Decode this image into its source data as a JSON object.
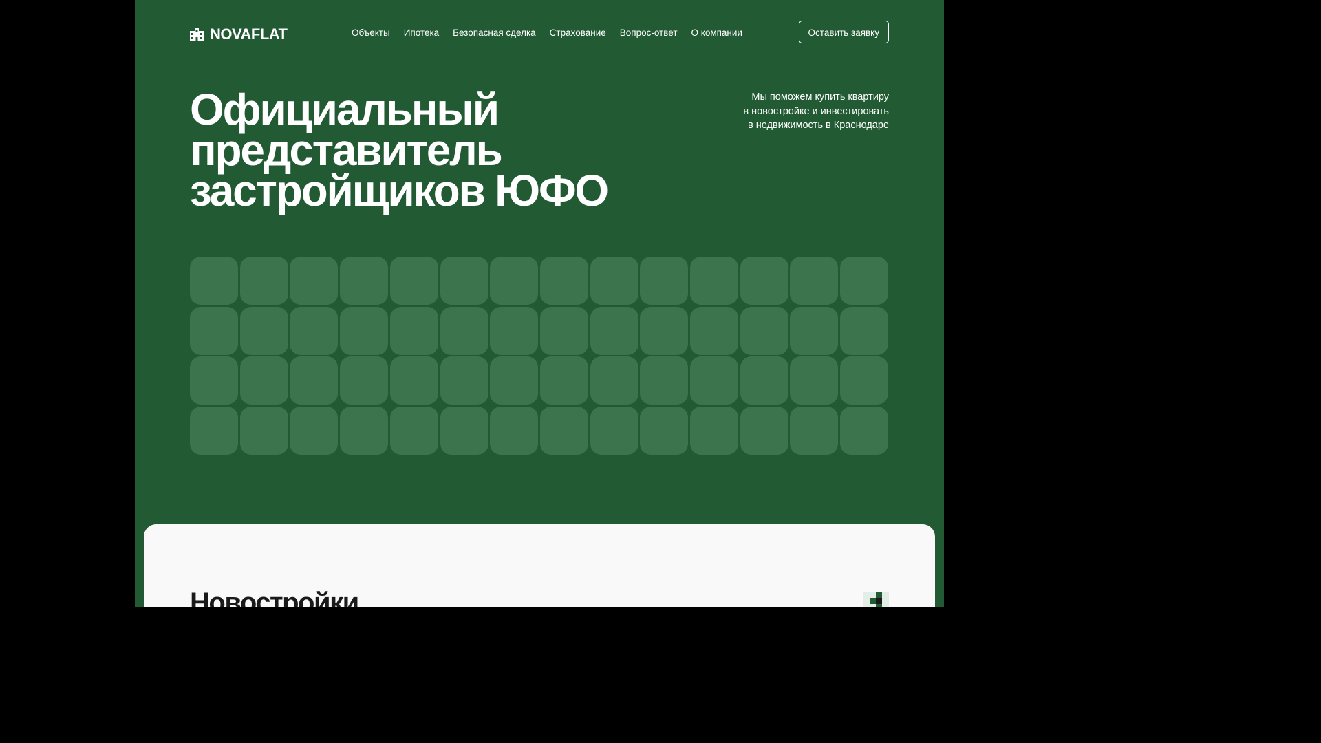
{
  "brand": {
    "name": "NOVAFLAT",
    "logo_icon": "building-icon"
  },
  "nav": {
    "items": [
      {
        "label": "Объекты"
      },
      {
        "label": "Ипотека"
      },
      {
        "label": "Безопасная сделка"
      },
      {
        "label": "Страхование"
      },
      {
        "label": "Вопрос-ответ"
      },
      {
        "label": "О компании"
      }
    ],
    "cta_label": "Оставить заявку"
  },
  "hero": {
    "title_lines": [
      "Официальный",
      "представитель",
      "застройщиков ЮФО"
    ],
    "subtitle_lines": [
      "Мы поможем купить квартиру",
      "в новостройке и инвестировать",
      "в недвижимость в Краснодаре"
    ]
  },
  "tiles": {
    "rows": 4,
    "columns": 14
  },
  "section": {
    "title": "Новостройки",
    "icon": "pixel-mark-icon"
  },
  "colors": {
    "background": "#225b33",
    "tile": "#3c744d",
    "panel": "#f9f9f9",
    "text_light": "#ffffff",
    "text_dark": "#1a1a1a"
  }
}
